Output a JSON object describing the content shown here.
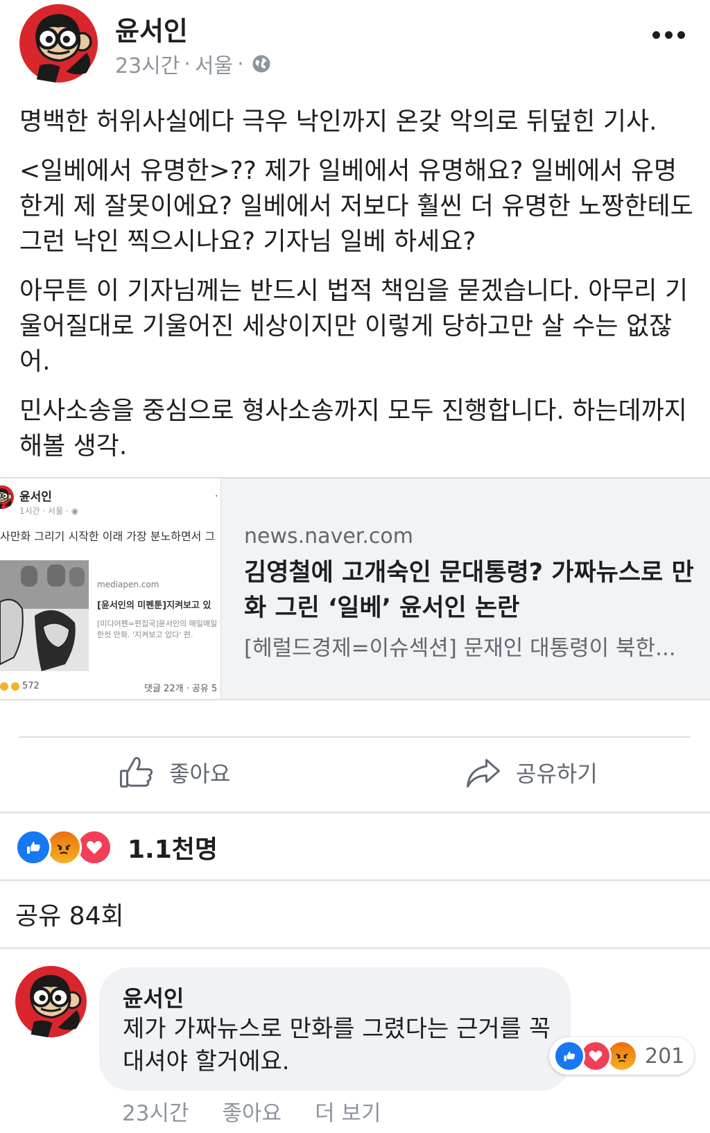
{
  "post": {
    "author": "윤서인",
    "time": "23시간",
    "location": "서울",
    "paragraphs": [
      "명백한 허위사실에다 극우 낙인까지 온갖 악의로 뒤덮힌 기사.",
      "<일베에서 유명한>?? 제가 일베에서 유명해요? 일베에서 유명한게 제 잘못이에요? 일베에서 저보다 훨씬 더 유명한 노짱한테도 그런 낙인 찍으시나요? 기자님 일베 하세요?",
      "아무튼 이 기자님께는 반드시 법적 책임을 묻겠습니다. 아무리 기울어질대로 기울어진 세상이지만 이렇게 당하고만 살 수는 없잖어.",
      "민사소송을 중심으로 형사소송까지 모두 진행합니다. 하는데까지 해볼 생각."
    ]
  },
  "link": {
    "domain": "news.naver.com",
    "headline": "김영철에 고개숙인 문대통령? 가짜뉴스로 만화 그린 ‘일베’ 윤서인 논란",
    "description": "[헤럴드경제=이슈섹션] 문재인 대통령이 북한...",
    "thumbnail": {
      "author": "윤서인",
      "meta": "1시간 · 서울 · ",
      "text": "사만화 그리기 시작한 이래 가장 분노하면서 그",
      "source": "mediapen.com",
      "headline": "[윤서인의 미펜툰]지켜보고 있",
      "desc": "[미디어펜=편집국]윤서인의 매일매일 한컷 만화. '지켜보고 있다' 편.",
      "reactions": "572",
      "stats": "댓글 22개 · 공유 5"
    }
  },
  "actions": {
    "like_label": "좋아요",
    "share_label": "공유하기"
  },
  "reactions": {
    "count": "1.1천명",
    "types": [
      "like-icon",
      "angry-icon",
      "love-icon"
    ]
  },
  "shares": {
    "label": "공유 84회"
  },
  "comment": {
    "author": "윤서인",
    "text": "제가 가짜뉴스로 만화를 그렸다는 근거를 꼭 대셔야 할거에요.",
    "reaction_count": "201",
    "time": "23시간",
    "like_label": "좋아요",
    "more_label": "더 보기"
  },
  "colors": {
    "facebook_blue": "#1877f2",
    "love_red": "#f33e58",
    "angry_orange": "#e9710f",
    "secondary_text": "#606770",
    "avatar_red": "#d9262c"
  }
}
